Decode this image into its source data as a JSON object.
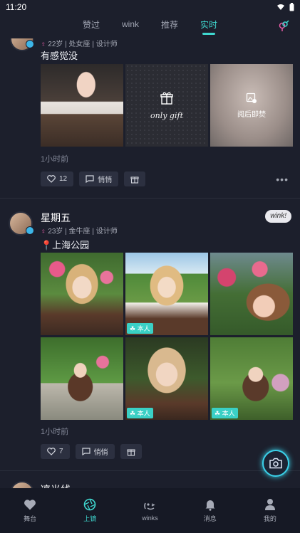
{
  "status": {
    "time": "11:20"
  },
  "tabs": [
    {
      "label": "赞过"
    },
    {
      "label": "wink"
    },
    {
      "label": "推荐"
    },
    {
      "label": "实时"
    }
  ],
  "posts": [
    {
      "meta": "22岁 | 处女座 | 设计师",
      "caption": "有感觉没",
      "gift_label": "only gift",
      "burn_label": "阅后即焚",
      "time": "1小时前",
      "likes": "12",
      "whisper": "悄悄"
    },
    {
      "name": "星期五",
      "meta": "23岁 | 金牛座 | 设计师",
      "location": "📍上海公园",
      "self_tag": "本人",
      "time": "1小时前",
      "likes": "7",
      "whisper": "悄悄",
      "wink_chip": "wink!"
    },
    {
      "name": "凉光线"
    }
  ],
  "bottom_nav": [
    {
      "label": "舞台"
    },
    {
      "label": "上镜"
    },
    {
      "label": "winks"
    },
    {
      "label": "消息"
    },
    {
      "label": "我的"
    }
  ],
  "colors": {
    "accent": "#3fd7cf",
    "background": "#1c1f2c"
  }
}
